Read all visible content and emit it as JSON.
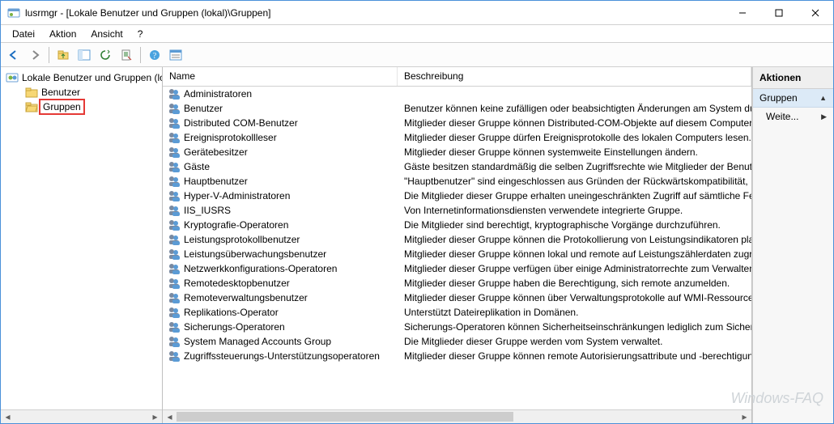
{
  "title": "lusrmgr - [Lokale Benutzer und Gruppen (lokal)\\Gruppen]",
  "menu": {
    "file": "Datei",
    "action": "Aktion",
    "view": "Ansicht",
    "help": "?"
  },
  "tree": {
    "root": "Lokale Benutzer und Gruppen (lokal)",
    "users": "Benutzer",
    "groups": "Gruppen"
  },
  "columns": {
    "name": "Name",
    "desc": "Beschreibung"
  },
  "groups": [
    {
      "name": "Administratoren",
      "desc": ""
    },
    {
      "name": "Benutzer",
      "desc": "Benutzer können keine zufälligen oder beabsichtigten Änderungen am System durchführen"
    },
    {
      "name": "Distributed COM-Benutzer",
      "desc": "Mitglieder dieser Gruppe können Distributed-COM-Objekte auf diesem Computer starten"
    },
    {
      "name": "Ereignisprotokollleser",
      "desc": "Mitglieder dieser Gruppe dürfen Ereignisprotokolle des lokalen Computers lesen."
    },
    {
      "name": "Gerätebesitzer",
      "desc": "Mitglieder dieser Gruppe können systemweite Einstellungen ändern."
    },
    {
      "name": "Gäste",
      "desc": "Gäste besitzen standardmäßig die selben Zugriffsrechte wie Mitglieder der Benutzer-Gruppe"
    },
    {
      "name": "Hauptbenutzer",
      "desc": "\"Hauptbenutzer\" sind eingeschlossen aus Gründen der Rückwärtskompatibilität,"
    },
    {
      "name": "Hyper-V-Administratoren",
      "desc": "Die Mitglieder dieser Gruppe erhalten uneingeschränkten Zugriff auf sämtliche Features"
    },
    {
      "name": "IIS_IUSRS",
      "desc": "Von Internetinformationsdiensten verwendete integrierte Gruppe."
    },
    {
      "name": "Kryptografie-Operatoren",
      "desc": "Die Mitglieder sind berechtigt, kryptographische Vorgänge durchzuführen."
    },
    {
      "name": "Leistungsprotokollbenutzer",
      "desc": "Mitglieder dieser Gruppe können die Protokollierung von Leistungsindikatoren planen"
    },
    {
      "name": "Leistungsüberwachungsbenutzer",
      "desc": "Mitglieder dieser Gruppe können lokal und remote auf Leistungszählerdaten zugreifen"
    },
    {
      "name": "Netzwerkkonfigurations-Operatoren",
      "desc": "Mitglieder dieser Gruppe verfügen über einige Administratorrechte zum Verwalten"
    },
    {
      "name": "Remotedesktopbenutzer",
      "desc": "Mitglieder dieser Gruppe haben die Berechtigung, sich remote anzumelden."
    },
    {
      "name": "Remoteverwaltungsbenutzer",
      "desc": "Mitglieder dieser Gruppe können über Verwaltungsprotokolle auf WMI-Ressourcen zugreifen"
    },
    {
      "name": "Replikations-Operator",
      "desc": "Unterstützt Dateireplikation in Domänen."
    },
    {
      "name": "Sicherungs-Operatoren",
      "desc": "Sicherungs-Operatoren können Sicherheitseinschränkungen lediglich zum Sichern"
    },
    {
      "name": "System Managed Accounts Group",
      "desc": "Die Mitglieder dieser Gruppe werden vom System verwaltet."
    },
    {
      "name": "Zugriffssteuerungs-Unterstützungsoperatoren",
      "desc": "Mitglieder dieser Gruppe können remote Autorisierungsattribute und -berechtigungen"
    }
  ],
  "actions": {
    "header": "Aktionen",
    "section": "Gruppen",
    "more": "Weite..."
  },
  "watermark": "Windows-FAQ"
}
